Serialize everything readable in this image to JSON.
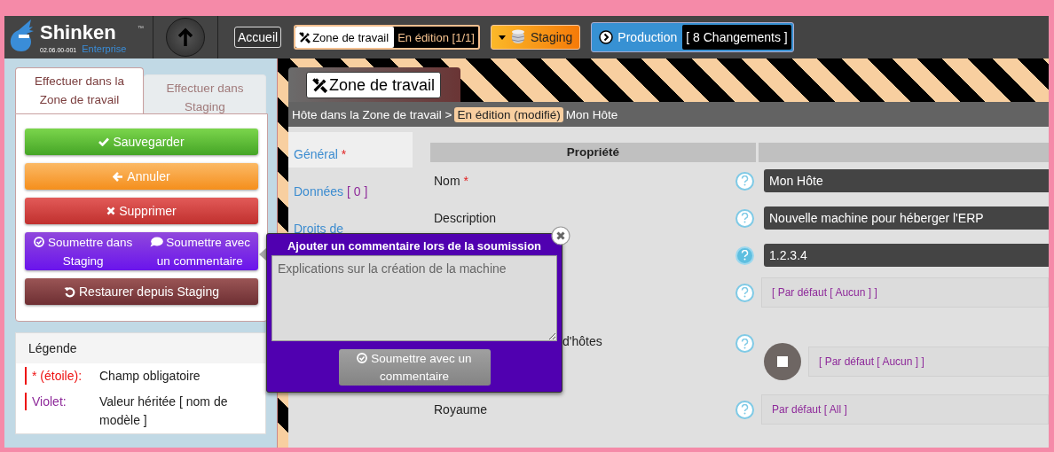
{
  "logo": {
    "name": "Shinken",
    "tm": "™",
    "edition": "Enterprise",
    "version": "02.06.00-001"
  },
  "topnav": {
    "home": "Accueil",
    "workspace": {
      "label": "Zone de travail",
      "status": "En édition [1/1]"
    },
    "staging": {
      "label": "Staging"
    },
    "production": {
      "label": "Production",
      "changes": "[ 8 Changements ]"
    }
  },
  "side_tabs": [
    {
      "label": "Effectuer dans la Zone de travail",
      "selected": true
    },
    {
      "label": "Effectuer dans Staging",
      "selected": false
    }
  ],
  "actions": [
    {
      "kind": "save",
      "label": "Sauvegarder"
    },
    {
      "kind": "cancel",
      "label": "Annuler"
    },
    {
      "kind": "delete",
      "label": "Supprimer"
    },
    {
      "kind": "submit",
      "items": [
        {
          "kind": "check",
          "label": "Soumettre dans Staging"
        },
        {
          "kind": "comment",
          "label": "Soumettre avec un commentaire"
        }
      ]
    },
    {
      "kind": "restore",
      "label": "Restaurer depuis Staging"
    }
  ],
  "legend": {
    "title": "Légende",
    "items": [
      {
        "term": "* (étoile):",
        "description": "Champ obligatoire",
        "color": "#ee1111"
      },
      {
        "term": "Violet:",
        "description": "Valeur héritée [ nom de modèle ]",
        "color": "#8e2a9a"
      }
    ]
  },
  "zone_tab": "Zone de travail",
  "breadcrumb": {
    "path": "Hôte dans la Zone de travail >",
    "status": "En édition (modifié)",
    "name": "Mon Hôte"
  },
  "sections": [
    {
      "label": "Général",
      "marker": "*",
      "selected": true
    },
    {
      "label": "Données",
      "count": "[ 0 ]",
      "selected": false
    },
    {
      "label": "Droits de",
      "selected": false
    }
  ],
  "table": {
    "header": "Propriété",
    "rows": [
      {
        "label": "Nom",
        "marker": "*",
        "kind": "input",
        "value": "Mon Hôte",
        "help_active": false
      },
      {
        "label": "Description",
        "kind": "input",
        "value": "Nouvelle machine pour héberger l'ERP",
        "help_active": false
      },
      {
        "kind": "input",
        "value": "1.2.3.4",
        "help_active": true
      },
      {
        "kind": "inherited",
        "value": "[ Par défaut [ Aucun ] ]",
        "help_active": false
      },
      {
        "label": "d'hôtes",
        "kind": "toggle",
        "value": "[ Par défaut [ Aucun ] ]",
        "help_active": false
      },
      {
        "label": "Royaume",
        "kind": "default",
        "value": "Par défaut [ All ]",
        "help_active": false
      }
    ]
  },
  "popup": {
    "title": "Ajouter un commentaire lors de la soumission",
    "comment": "Explications sur la création de la machine",
    "button": "Soumettre avec un commentaire"
  }
}
